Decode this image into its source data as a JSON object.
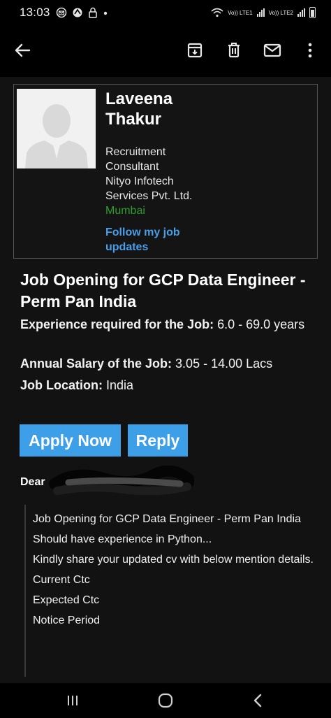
{
  "status_bar": {
    "time": "13:03",
    "notification_icons": [
      "email-icon",
      "app-icon",
      "lock-icon",
      "dot-icon"
    ],
    "sim1": "Vo)) LTE1",
    "sim2": "Vo)) LTE2"
  },
  "app_bar": {
    "icons": [
      "back-arrow-icon",
      "archive-icon",
      "delete-icon",
      "mail-icon",
      "more-icon"
    ]
  },
  "recruiter": {
    "name": "Laveena Thakur",
    "title": "Recruitment Consultant",
    "company": "Nityo Infotech Services Pvt. Ltd.",
    "city": "Mumbai",
    "follow_link": "Follow my job updates"
  },
  "job": {
    "title": "Job Opening for GCP Data Engineer - Perm Pan India",
    "experience_label": "Experience required for the Job:",
    "experience_value": "6.0 - 69.0 years",
    "salary_label": "Annual Salary of the Job:",
    "salary_value": "3.05 - 14.00 Lacs",
    "location_label": "Job Location:",
    "location_value": "India"
  },
  "buttons": {
    "apply": "Apply Now",
    "reply": "Reply"
  },
  "greeting": "Dear",
  "body_lines": [
    "Job Opening for GCP Data Engineer - Perm Pan India",
    "Should have experience in Python...",
    "Kindly share your updated cv with below mention details.",
    "Current Ctc",
    "Expected Ctc",
    "Notice Period"
  ],
  "nav_bar": {
    "icons": [
      "recents-icon",
      "home-icon",
      "back-icon"
    ]
  }
}
